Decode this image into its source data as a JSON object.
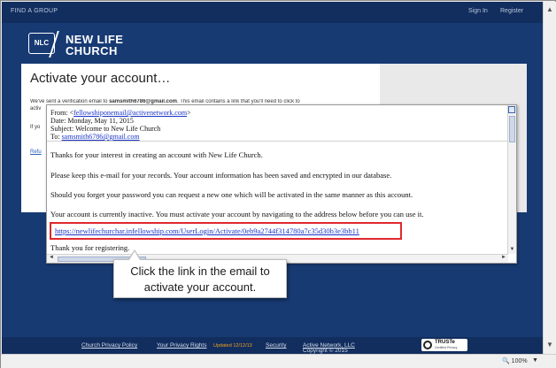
{
  "topbar": {
    "find_group": "FIND A GROUP",
    "sign_in": "Sign In",
    "register": "Register"
  },
  "logo": {
    "mark": "NLC",
    "line1": "NEW LIFE",
    "line2": "CHURCH"
  },
  "page": {
    "title": "Activate your account…",
    "sent_line_prefix": "We've sent a verification email to ",
    "sent_email": "samsmith6786@gmail.com",
    "sent_line_suffix": ". This email contains a link that you'll need to click to",
    "cont1": "activ",
    "cont2": "If yo",
    "refu": "Refu"
  },
  "email": {
    "from_label": "From: <",
    "from_addr": "fellowshiponemail@activenetwork.com",
    "from_end": ">",
    "date": "Date: Monday, May 11, 2015",
    "subject": "Subject: Welcome to New Life Church",
    "to_label": "To: ",
    "to_addr": "samsmith6786@gmail.com",
    "p1": "Thanks for your interest in creating an account with New Life Church.",
    "p2": "Please keep this e-mail for your records. Your account information has been saved and encrypted in our database.",
    "p3": "Should you forget your password you can request a new one which will be activated in the same manner as this account.",
    "p4": "Your account is currently inactive. You must activate your account by navigating to the address below before you can use it.",
    "link": "https://newlifechurchar.infellowship.com/UserLogin/Activate/0eb9a2744f314780a7c35d30b3e3bb11",
    "p5": "Thank you for registering."
  },
  "callout": {
    "line1": "Click the link in the email to",
    "line2": "activate your account."
  },
  "footer": {
    "privacy": "Church Privacy Policy",
    "rights": "Your Privacy Rights",
    "updated": "Updated 12/12/13",
    "security": "Security",
    "copyright_prefix": "Copyright © 2015 ",
    "active_network": "Active Network, LLC",
    "truste": "TRUSTe",
    "truste_sub": "Certified Privacy"
  },
  "status": {
    "zoom": "100%"
  },
  "colors": {
    "brand_blue": "#173a73",
    "highlight_red": "#e0282d",
    "link_blue": "#1a35c7"
  },
  "icons": {
    "scroll_up": "▲",
    "scroll_down": "▼",
    "arrow_left": "◄",
    "arrow_right": "►",
    "zoom": "magnifier-icon"
  }
}
